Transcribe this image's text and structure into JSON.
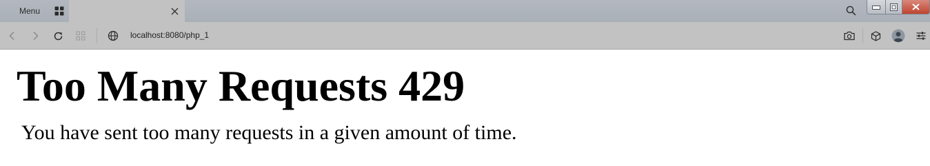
{
  "browser": {
    "menu_label": "Menu",
    "address": "localhost:8080/php_1",
    "icons": {
      "tabs_overview": "tabs-grid-icon",
      "tab_close": "close-icon",
      "search_tabs": "search-icon",
      "back": "back-arrow-icon",
      "forward": "forward-arrow-icon",
      "reload": "reload-icon",
      "speed_dial": "speed-dial-icon",
      "site_info": "globe-icon",
      "snapshot": "camera-icon",
      "extensions": "cube-icon",
      "profile": "avatar-icon",
      "easy_setup": "sliders-icon",
      "minimize": "minimize-icon",
      "restore": "restore-icon",
      "close_window": "close-window-icon"
    },
    "colors": {
      "titlebar": "#aab0b8",
      "toolbar": "#c2c2c2",
      "close_button": "#c0442f"
    }
  },
  "page": {
    "title": "Too Many Requests 429",
    "message": "You have sent too many requests in a given amount of time."
  }
}
